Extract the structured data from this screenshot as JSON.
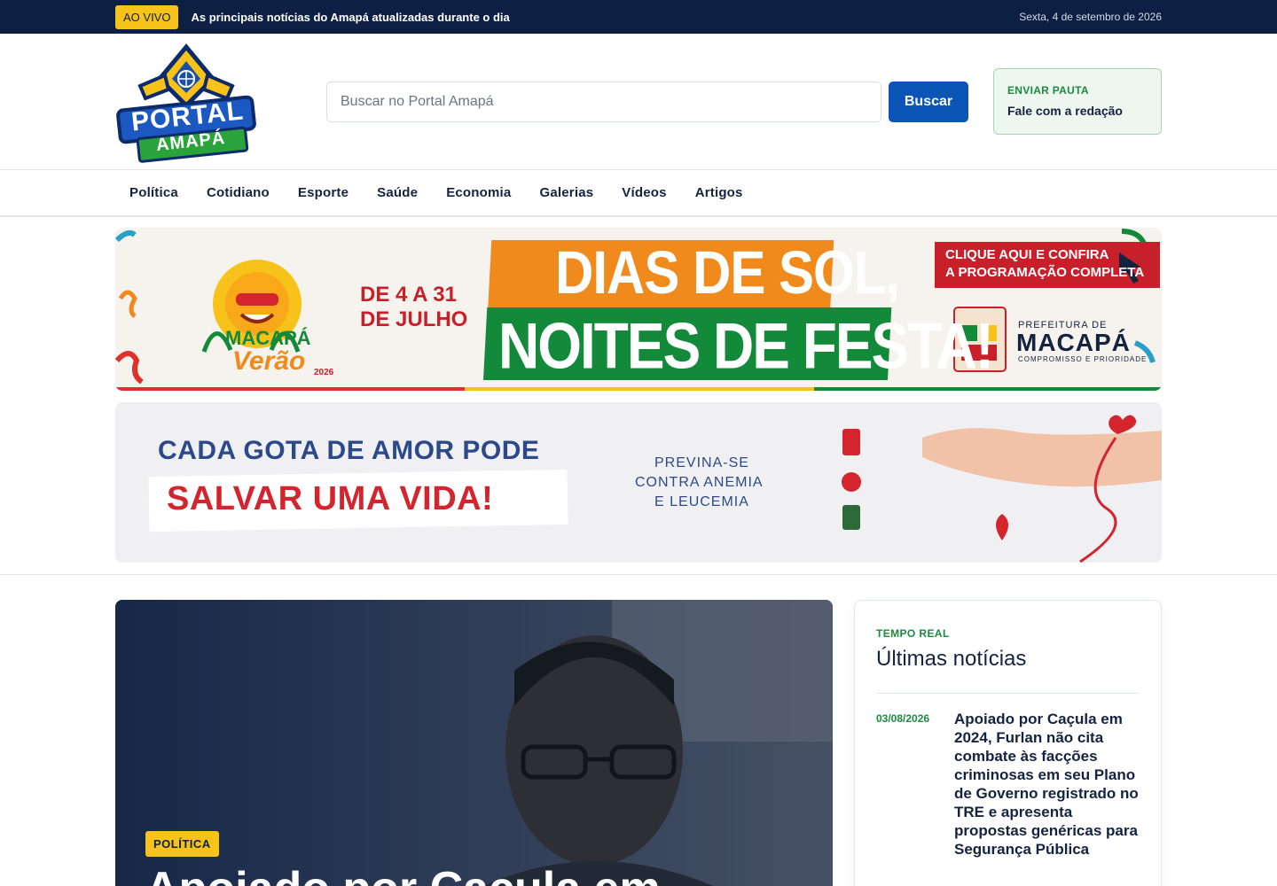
{
  "topbar": {
    "live_label": "AO VIVO",
    "message": "As principais notícias do Amapá atualizadas durante o dia",
    "date": "Sexta, 4 de setembro de 2026"
  },
  "header": {
    "logo_line1": "PORTAL",
    "logo_line2": "AMAPÁ",
    "search_placeholder": "Buscar no Portal Amapá",
    "search_button": "Buscar",
    "pauta_title": "ENVIAR PAUTA",
    "pauta_subtitle": "Fale com a redação"
  },
  "nav": {
    "items": [
      "Política",
      "Cotidiano",
      "Esporte",
      "Saúde",
      "Economia",
      "Galerias",
      "Vídeos",
      "Artigos"
    ]
  },
  "banner1": {
    "festival_name": "MACAPÁ",
    "festival_sub": "Verão",
    "festival_year": "2026",
    "dates": [
      "DE 4 A 31",
      "DE JULHO"
    ],
    "headline1": "DIAS DE SOL,",
    "headline2": "NOITES DE FESTA!",
    "cta_line1": "CLIQUE AQUI E CONFIRA",
    "cta_line2": "A PROGRAMAÇÃO COMPLETA",
    "org_prefix": "PREFEITURA DE",
    "org_name": "MACAPÁ",
    "org_slogan": "COMPROMISSO E PRIORIDADE",
    "colors": {
      "orange": "#f08a1c",
      "green": "#128a3a",
      "red": "#c8202b"
    }
  },
  "banner2": {
    "line1": "CADA GOTA DE AMOR PODE",
    "line2": "SALVAR UMA VIDA!",
    "side_lines": [
      "PREVINA-SE",
      "CONTRA ANEMIA",
      "E LEUCEMIA"
    ],
    "colors": {
      "navy": "#2c4a8a",
      "red": "#d4242e"
    }
  },
  "hero": {
    "tag": "POLÍTICA",
    "title": "Apoiado por Caçula em"
  },
  "sidebar": {
    "kicker": "TEMPO REAL",
    "title": "Últimas notícias",
    "items": [
      {
        "date": "03/08/2026",
        "title": "Apoiado por Caçula em 2024, Furlan não cita combate às facções criminosas em seu Plano de Governo registrado no TRE e apresenta propostas genéricas para Segurança Pública"
      }
    ]
  }
}
